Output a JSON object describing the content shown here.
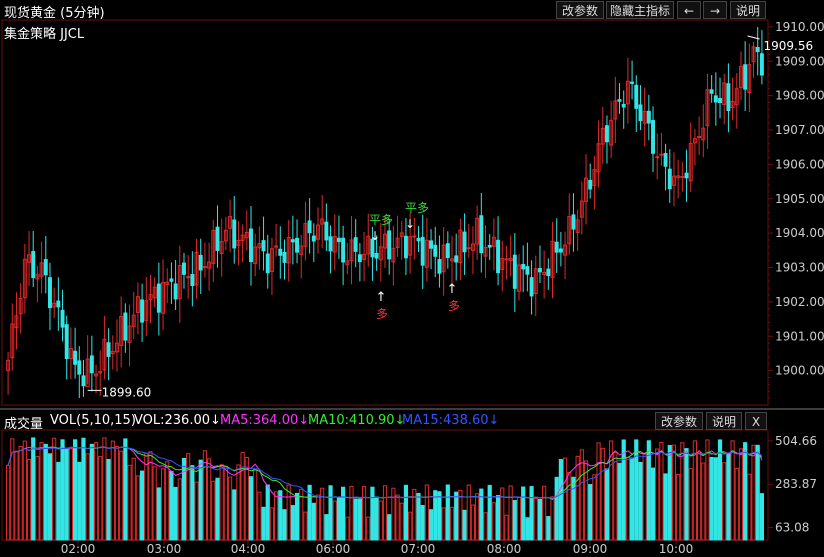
{
  "header": {
    "title": "现货黄金 (5分钟)",
    "buttons": [
      "改参数",
      "隐藏主指标",
      "←",
      "→",
      "说明"
    ]
  },
  "strategy": "集金策略 JJCL",
  "price_axis": [
    "1910.00",
    "1909.00",
    "1908.00",
    "1907.00",
    "1906.00",
    "1905.00",
    "1904.00",
    "1903.00",
    "1902.00",
    "1901.00",
    "1900.00"
  ],
  "time_axis": [
    "02:00",
    "03:00",
    "04:00",
    "06:00",
    "07:00",
    "08:00",
    "09:00",
    "10:00"
  ],
  "annotations": {
    "high_label": "1909.56",
    "low_label": "1899.60",
    "signals": [
      {
        "text": "平多",
        "color": "#33dd33"
      },
      {
        "text": "平多",
        "color": "#33dd33"
      },
      {
        "text": "多",
        "color": "#ff3333"
      },
      {
        "text": "多",
        "color": "#ff3333"
      }
    ],
    "arrow_down": "↓",
    "arrow_up": "↑"
  },
  "volume_header": {
    "name": "成交量",
    "params": "VOL(5,10,15)",
    "vol": "VOL:236.00↓",
    "ma5": "MA5:364.00↓",
    "ma10": "MA10:410.90↓",
    "ma15": "MA15:438.60↓",
    "buttons": [
      "改参数",
      "说明",
      "X"
    ]
  },
  "volume_axis": [
    "504.66",
    "283.87",
    "63.08"
  ],
  "colors": {
    "up": "#dd2a2a",
    "down": "#33e6e6",
    "ma5": "#ff33ff",
    "ma10": "#33ee33",
    "ma15": "#3355ff",
    "grid": "#6a1010"
  },
  "chart_data": {
    "type": "candlestick",
    "interval": "5min",
    "ylim": [
      1899.0,
      1910.2
    ],
    "high": 1909.56,
    "low": 1899.6,
    "volume_ylim": [
      0,
      560
    ],
    "note_values": "approximate OHLC values read from the chart"
  }
}
